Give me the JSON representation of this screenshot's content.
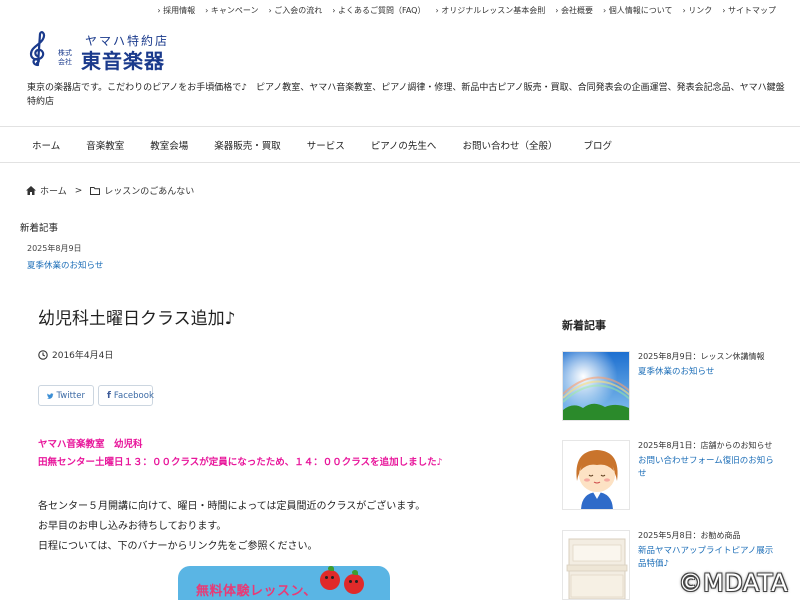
{
  "top_nav": [
    "採用情報",
    "キャンペーン",
    "ご入会の流れ",
    "よくあるご質問（FAQ）",
    "オリジナルレッスン基本会則",
    "会社概要",
    "個人情報について",
    "リンク",
    "サイトマップ"
  ],
  "logo": {
    "kanji_label": "ヤマハ特約店",
    "kaisha_line1": "株式",
    "kaisha_line2": "会社",
    "name": "東音楽器",
    "icon": "treble-clef-icon"
  },
  "tagline": "東京の楽器店です。こだわりのピアノをお手頃価格で♪　ピアノ教室、ヤマハ音楽教室、ピアノ調律・修理、新品中古ピアノ販売・買取、合同発表会の企画運営、発表会記念品、ヤマハ鍵盤特約店",
  "main_nav": [
    "ホーム",
    "音楽教室",
    "教室会場",
    "楽器販売・買取",
    "サービス",
    "ピアノの先生へ",
    "お問い合わせ（全般）",
    "ブログ"
  ],
  "breadcrumb": {
    "home": "ホーム",
    "separator": ">",
    "category": "レッスンのごあんない"
  },
  "recent_top": {
    "heading": "新着記事",
    "date": "2025年8月9日",
    "link": "夏季休業のお知らせ"
  },
  "post": {
    "title": "幼児科土曜日クラス追加♪",
    "date": "2016年4月4日",
    "share_twitter": "Twitter",
    "share_facebook": "Facebook",
    "highlight_line1": "ヤマハ音楽教室　幼児科",
    "highlight_line2": "田無センター土曜日１３：００クラスが定員になったため、１４：００クラスを追加しました♪",
    "body_line1": "各センター５月開講に向けて、曜日・時間によっては定員間近のクラスがございます。",
    "body_line2": "お早目のお申し込みお待ちしております。",
    "body_line3": "日程については、下のバナーからリンク先をご参照ください。",
    "banner_text": "無料体験レッスン、"
  },
  "sidebar": {
    "heading": "新着記事",
    "items": [
      {
        "meta": "2025年8月9日：レッスン休講情報",
        "link": "夏季休業のお知らせ"
      },
      {
        "meta": "2025年8月1日：店舗からのお知らせ",
        "link": "お問い合わせフォーム復旧のお知らせ"
      },
      {
        "meta": "2025年5月8日：お勧め商品",
        "link": "新品ヤマハアップライトピアノ展示品特価♪"
      }
    ]
  },
  "copyright": "©MDATA",
  "colors": {
    "link": "#1e6fb8",
    "highlight": "#e8169b",
    "brand": "#1a3a8c"
  }
}
